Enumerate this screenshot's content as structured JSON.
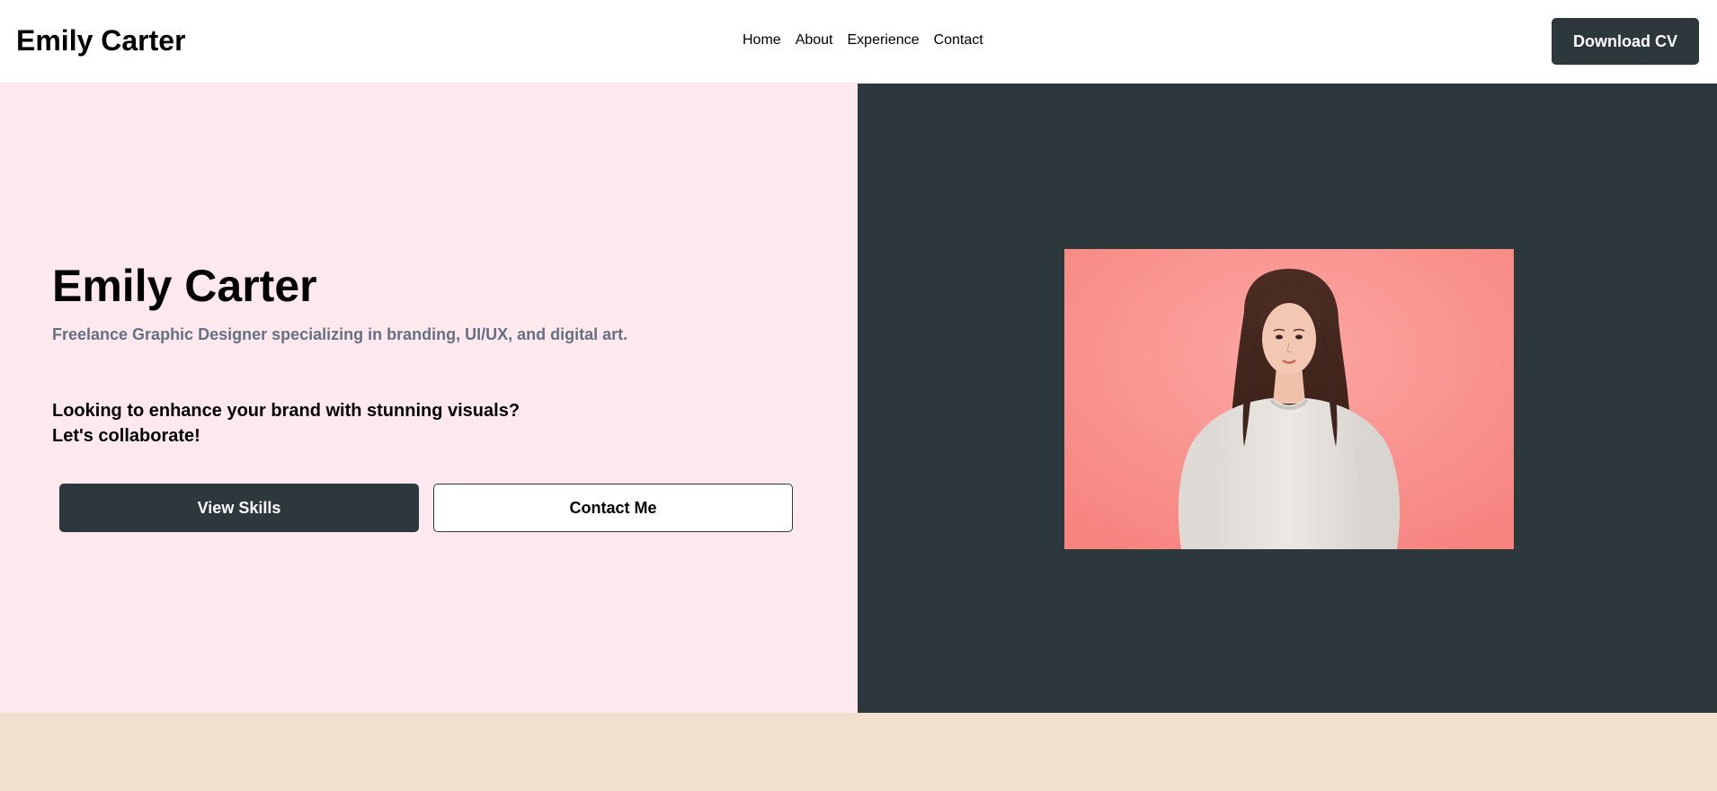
{
  "header": {
    "brand": "Emily Carter",
    "nav": [
      {
        "label": "Home"
      },
      {
        "label": "About"
      },
      {
        "label": "Experience"
      },
      {
        "label": "Contact"
      }
    ],
    "cv_button": "Download CV"
  },
  "hero": {
    "title": "Emily Carter",
    "subtitle": "Freelance Graphic Designer specializing in branding, UI/UX, and digital art.",
    "pitch_line1": "Looking to enhance your brand with stunning visuals?",
    "pitch_line2": "Let's collaborate!",
    "primary_button": "View Skills",
    "secondary_button": "Contact Me"
  },
  "colors": {
    "accent_dark": "#2d383c",
    "hero_bg": "#ffe9ee",
    "subtitle": "#637182",
    "photo_bg": "#fa9a96",
    "next_section_bg": "#f2e0cf"
  }
}
